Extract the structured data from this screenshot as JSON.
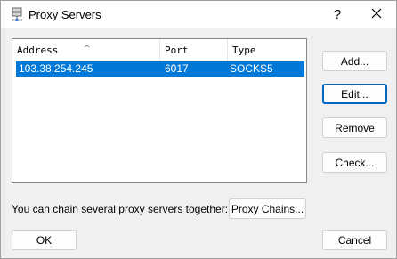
{
  "window": {
    "title": "Proxy Servers",
    "help_label": "?"
  },
  "list": {
    "columns": [
      "Address",
      "Port",
      "Type"
    ],
    "sorted_column": "Address",
    "sort_direction": "ascending",
    "rows": [
      {
        "address": "103.38.254.245",
        "port": "6017",
        "type": "SOCKS5",
        "selected": true
      }
    ]
  },
  "buttons": {
    "add": "Add...",
    "edit": "Edit...",
    "remove": "Remove",
    "check": "Check...",
    "proxy_chains": "Proxy Chains...",
    "ok": "OK",
    "cancel": "Cancel"
  },
  "chain_text": "You can chain several proxy servers together:",
  "colors": {
    "selection": "#0078d7",
    "focus_border": "#0067c0"
  }
}
